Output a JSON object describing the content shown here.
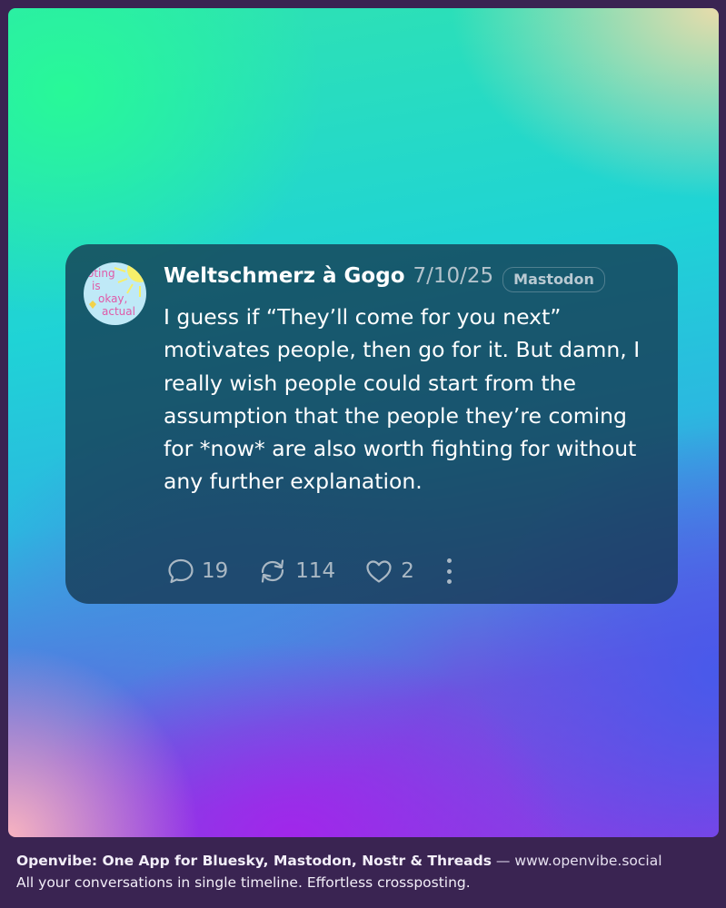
{
  "post": {
    "author_name": "Weltschmerz à Gogo",
    "date": "7/10/25",
    "network": "Mastodon",
    "avatar_icon": "voting-sun-sticker-icon",
    "avatar_text": [
      "oting",
      "is",
      "okay,",
      "actual"
    ],
    "body": "I guess if “They’ll come for you next” motivates people, then go for it. But damn, I really wish people could start from the assumption that the people they’re coming for *now* are also worth fighting for without any further explanation.",
    "actions": {
      "replies": "19",
      "reposts": "114",
      "likes": "2",
      "reply_icon": "speech-bubble-icon",
      "repost_icon": "repost-arrows-icon",
      "like_icon": "heart-icon",
      "more_icon": "vertical-ellipsis-icon"
    }
  },
  "footer": {
    "brand": "Openvibe: One App for Bluesky, Mastodon, Nostr & Threads",
    "separator": "—",
    "url": "www.openvibe.social",
    "tagline": "All your conversations in single timeline. Effortless crossposting."
  },
  "colors": {
    "card_background": "#14374f",
    "icon_gray": "#aab8c4",
    "date_gray": "#b3c3cc"
  }
}
